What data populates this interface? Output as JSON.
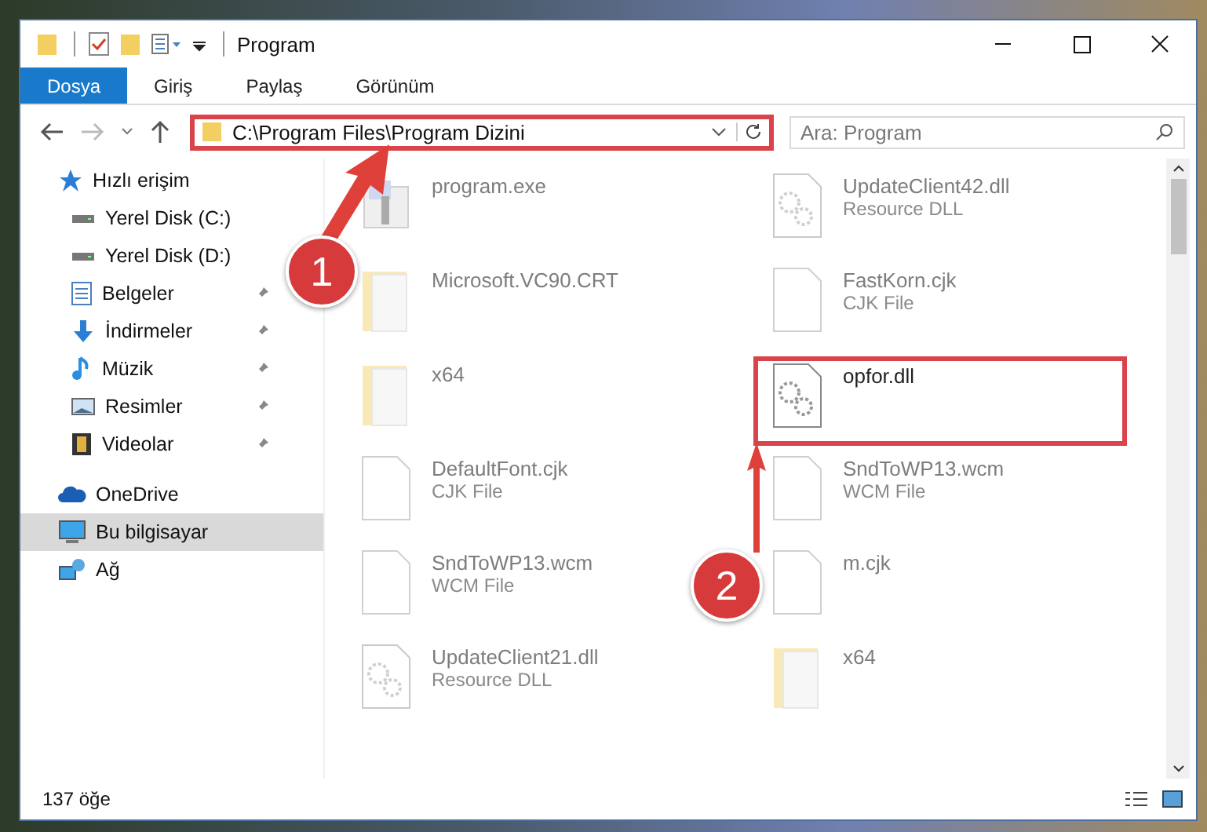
{
  "window": {
    "title": "Program"
  },
  "ribbon_tabs": [
    {
      "label": "Dosya",
      "selected": true
    },
    {
      "label": "Giriş",
      "selected": false
    },
    {
      "label": "Paylaş",
      "selected": false
    },
    {
      "label": "Görünüm",
      "selected": false
    }
  ],
  "address_bar": {
    "path": "C:\\Program Files\\Program Dizini"
  },
  "search": {
    "placeholder": "Ara: Program"
  },
  "sidebar": {
    "items": [
      {
        "label": "Hızlı erişim",
        "kind": "star",
        "selected": false,
        "children": [
          {
            "label": "Yerel Disk (C:)",
            "kind": "drive",
            "pinned": false,
            "selected": false
          },
          {
            "label": "Yerel Disk (D:)",
            "kind": "drive",
            "pinned": false,
            "selected": false
          },
          {
            "label": "Belgeler",
            "kind": "documents",
            "pinned": true,
            "selected": false
          },
          {
            "label": "İndirmeler",
            "kind": "download",
            "pinned": true,
            "selected": false
          },
          {
            "label": "Müzik",
            "kind": "music",
            "pinned": true,
            "selected": false
          },
          {
            "label": "Resimler",
            "kind": "pictures",
            "pinned": true,
            "selected": false
          },
          {
            "label": "Videolar",
            "kind": "videos",
            "pinned": true,
            "selected": false
          }
        ]
      },
      {
        "label": "OneDrive",
        "kind": "cloud",
        "selected": false
      },
      {
        "label": "Bu bilgisayar",
        "kind": "computer",
        "selected": true
      },
      {
        "label": "Ağ",
        "kind": "network",
        "selected": false
      }
    ]
  },
  "files": [
    {
      "name": "program.exe",
      "kind": "exe",
      "dimmed": true,
      "highlighted": false
    },
    {
      "name": "UpdateClient42.dll",
      "type": "Resource DLL",
      "kind": "dll",
      "dimmed": true,
      "highlighted": false
    },
    {
      "name": "Microsoft.VC90.CRT",
      "kind": "folder",
      "dimmed": true,
      "highlighted": false
    },
    {
      "name": "FastKorn.cjk",
      "type": "CJK File",
      "kind": "file",
      "dimmed": true,
      "highlighted": false
    },
    {
      "name": "x64",
      "kind": "folder",
      "dimmed": true,
      "highlighted": false
    },
    {
      "name": "opfor.dll",
      "kind": "dll",
      "dimmed": false,
      "highlighted": true
    },
    {
      "name": "DefaultFont.cjk",
      "type": "CJK File",
      "kind": "file",
      "dimmed": true,
      "highlighted": false
    },
    {
      "name": "SndToWP13.wcm",
      "type": "WCM File",
      "kind": "file",
      "dimmed": true,
      "highlighted": false
    },
    {
      "name": "SndToWP13.wcm",
      "type": "WCM File",
      "kind": "file",
      "dimmed": true,
      "highlighted": false
    },
    {
      "name": "m.cjk",
      "kind": "file",
      "dimmed": true,
      "highlighted": false
    },
    {
      "name": "UpdateClient21.dll",
      "type": "Resource DLL",
      "kind": "dll",
      "dimmed": true,
      "highlighted": false
    },
    {
      "name": "x64",
      "kind": "folder",
      "dimmed": true,
      "highlighted": false
    }
  ],
  "status_bar": {
    "count": "137 öğe"
  },
  "annotations": [
    {
      "number": "1"
    },
    {
      "number": "2"
    }
  ]
}
